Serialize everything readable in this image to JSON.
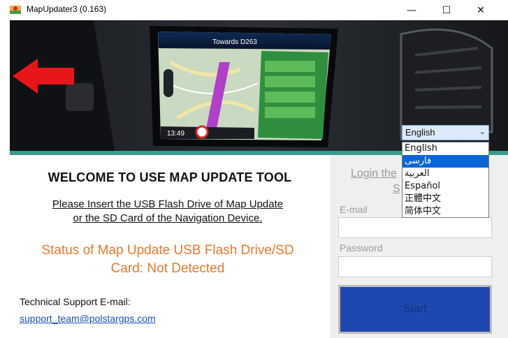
{
  "window": {
    "title": "MapUpdater3 (0.163)",
    "minimize_glyph": "—",
    "maximize_glyph": "☐",
    "close_glyph": "✕"
  },
  "banner": {
    "screen_direction": "Towards D263",
    "screen_time": "13:49"
  },
  "main": {
    "welcome": "WELCOME TO USE MAP UPDATE TOOL",
    "insert_line_1": "Please Insert the USB Flash Drive of Map Update",
    "insert_line_2": "or the SD Card of the Navigation Device.",
    "status_line_1": "Status of Map Update USB Flash Drive/SD",
    "status_line_2": "Card:  Not Detected",
    "support_label": "Technical Support E-mail:",
    "support_email": "support_team@polstargps.com"
  },
  "login": {
    "link_part_1": "Login the",
    "link_part_2": "S",
    "email_label": "E-mail",
    "email_value": "",
    "password_label": "Password",
    "password_value": "",
    "start_label": "Start"
  },
  "language": {
    "selected": "English",
    "options": [
      "English",
      "فارسی",
      "العربية",
      "Español",
      "正體中文",
      "简体中文"
    ],
    "highlighted_index": 1
  },
  "colors": {
    "accent_teal": "#3a9b8c",
    "status_orange": "#e8782c",
    "link_blue": "#1a4fb5",
    "start_blue": "#1f47b0",
    "arrow_red": "#e8161b"
  }
}
